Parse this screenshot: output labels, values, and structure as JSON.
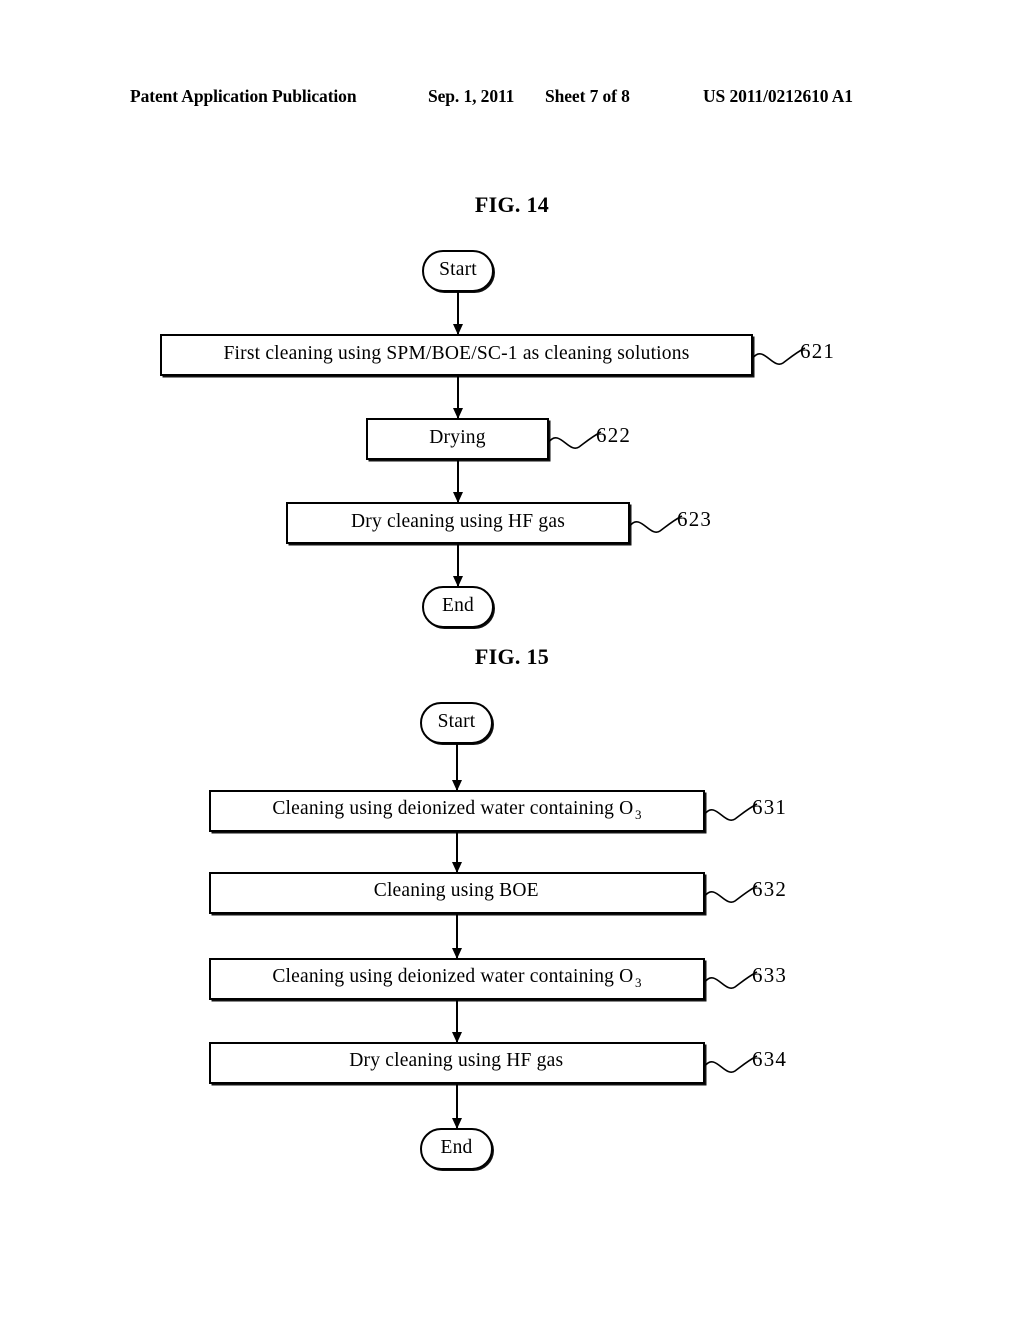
{
  "header": {
    "publication": "Patent Application Publication",
    "date": "Sep. 1, 2011",
    "sheet": "Sheet 7 of 8",
    "patent_number": "US 2011/0212610 A1"
  },
  "figures": [
    {
      "title": "FIG. 14",
      "start_label": "Start",
      "end_label": "End",
      "steps": [
        {
          "text": "First cleaning using SPM/BOE/SC-1 as cleaning solutions",
          "subscript": "",
          "ref": "621"
        },
        {
          "text": "Drying",
          "subscript": "",
          "ref": "622"
        },
        {
          "text": "Dry cleaning using HF gas",
          "subscript": "",
          "ref": "623"
        }
      ]
    },
    {
      "title": "FIG. 15",
      "start_label": "Start",
      "end_label": "End",
      "steps": [
        {
          "text": "Cleaning using deionized water containing O",
          "subscript": "3",
          "ref": "631"
        },
        {
          "text": "Cleaning using BOE",
          "subscript": "",
          "ref": "632"
        },
        {
          "text": "Cleaning using deionized water containing O",
          "subscript": "3",
          "ref": "633"
        },
        {
          "text": "Dry cleaning using HF gas",
          "subscript": "",
          "ref": "634"
        }
      ]
    }
  ],
  "colors": {
    "ink": "#000000",
    "paper": "#ffffff"
  }
}
